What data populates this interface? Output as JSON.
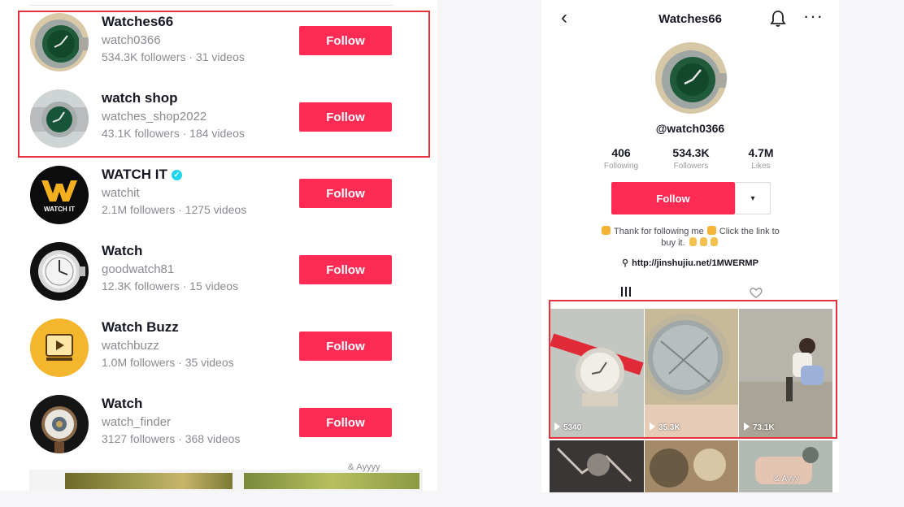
{
  "left": {
    "accounts": [
      {
        "name": "Watches66",
        "handle": "watch0366",
        "stats": "534.3K followers · 31 videos",
        "follow_label": "Follow",
        "verified": false
      },
      {
        "name": "watch shop",
        "handle": "watches_shop2022",
        "stats": "43.1K followers · 184 videos",
        "follow_label": "Follow",
        "verified": false
      },
      {
        "name": "WATCH IT",
        "handle": "watchit",
        "stats": "2.1M followers · 1275 videos",
        "follow_label": "Follow",
        "verified": true
      },
      {
        "name": "Watch",
        "handle": "goodwatch81",
        "stats": "12.3K followers · 15 videos",
        "follow_label": "Follow",
        "verified": false
      },
      {
        "name": "Watch Buzz",
        "handle": "watchbuzz",
        "stats": "1.0M followers · 35 videos",
        "follow_label": "Follow",
        "verified": false
      },
      {
        "name": "Watch",
        "handle": "watch_finder",
        "stats": "3127 followers · 368 videos",
        "follow_label": "Follow",
        "verified": false
      }
    ],
    "logo_text": {
      "watchit": "WATCH IT"
    },
    "watermark": "& Ауууу"
  },
  "right": {
    "title": "Watches66",
    "back_icon": "chevron-left-icon",
    "handle": "@watch0366",
    "stats": [
      {
        "value": "406",
        "label": "Following"
      },
      {
        "value": "534.3K",
        "label": "Followers"
      },
      {
        "value": "4.7M",
        "label": "Likes"
      }
    ],
    "follow_label": "Follow",
    "dropdown_icon": "▾",
    "bio": {
      "part1": "Thank for following me",
      "part2": "Click the link to",
      "part3": "buy it."
    },
    "link_text": "http://jinshujiu.net/1MWERMP",
    "videos": [
      {
        "views": "5340"
      },
      {
        "views": "35.3K"
      },
      {
        "views": "73.1K"
      }
    ],
    "watermark": "& Аууу"
  },
  "colors": {
    "accent": "#fe2c55",
    "highlight": "#e5323c",
    "verified": "#20d5ec"
  }
}
